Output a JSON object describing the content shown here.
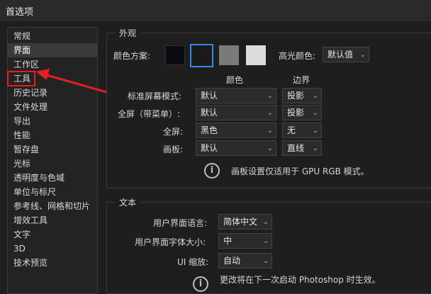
{
  "window": {
    "title": "首选项"
  },
  "sidebar": {
    "items": [
      {
        "label": "常规"
      },
      {
        "label": "界面",
        "selected": true
      },
      {
        "label": "工作区"
      },
      {
        "label": "工具",
        "highlight": true
      },
      {
        "label": "历史记录"
      },
      {
        "label": "文件处理"
      },
      {
        "label": "导出"
      },
      {
        "label": "性能"
      },
      {
        "label": "暂存盘"
      },
      {
        "label": "光标"
      },
      {
        "label": "透明度与色域"
      },
      {
        "label": "单位与标尺"
      },
      {
        "label": "参考线、网格和切片"
      },
      {
        "label": "增效工具"
      },
      {
        "label": "文字"
      },
      {
        "label": "3D"
      },
      {
        "label": "技术预览"
      }
    ]
  },
  "appearance": {
    "legend": "外观",
    "color_scheme_label": "颜色方案:",
    "swatches": [
      "#0b0b0f",
      "#1a1a1a",
      "#7a7a7a",
      "#dcdcdc"
    ],
    "selected_swatch": 1,
    "highlight_color_label": "高光颜色:",
    "highlight_color_value": "默认值",
    "col_color": "颜色",
    "col_border": "边界",
    "rows": [
      {
        "label": "标准屏幕模式:",
        "color": "默认",
        "border": "投影"
      },
      {
        "label": "全屏（带菜单）:",
        "color": "默认",
        "border": "投影"
      },
      {
        "label": "全屏:",
        "color": "黑色",
        "border": "无"
      },
      {
        "label": "画板:",
        "color": "默认",
        "border": "直线"
      }
    ],
    "artboard_note": "画板设置仅适用于 GPU RGB 模式。"
  },
  "text": {
    "legend": "文本",
    "ui_language_label": "用户界面语言:",
    "ui_language_value": "简体中文",
    "ui_font_size_label": "用户界面字体大小:",
    "ui_font_size_value": "中",
    "ui_scale_label": "UI 缩放:",
    "ui_scale_value": "自动",
    "restart_note": "更改将在下一次启动 Photoshop 时生效。"
  },
  "colors": {
    "annotation": "#e31e24",
    "accent": "#2d8ceb"
  }
}
